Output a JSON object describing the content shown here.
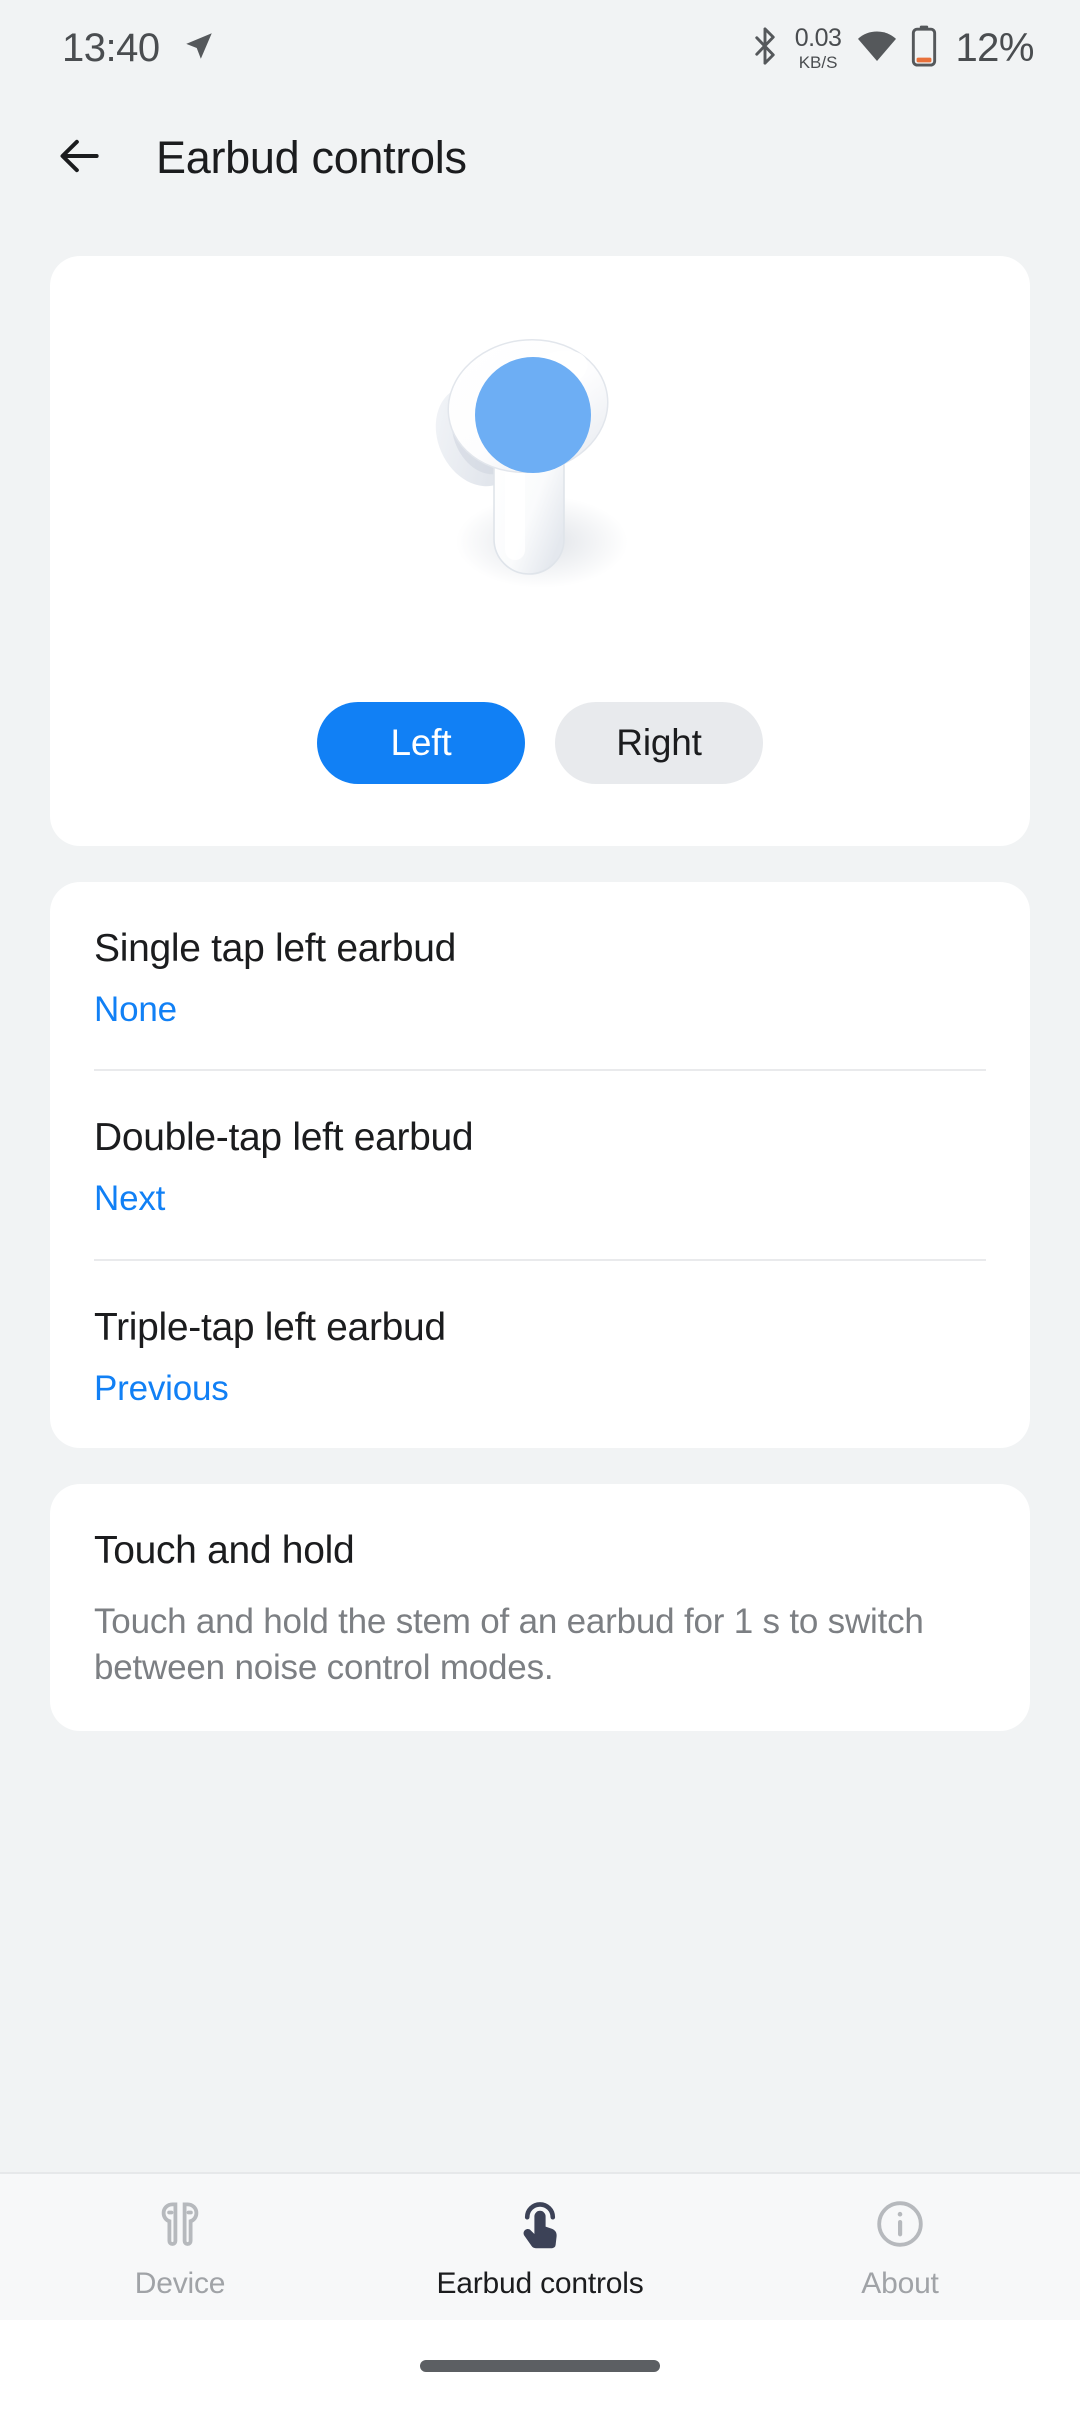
{
  "statusbar": {
    "time": "13:40",
    "location_icon": "navigation-arrow-icon",
    "bluetooth_icon": "bluetooth-icon",
    "net_speed_value": "0.03",
    "net_speed_unit": "KB/S",
    "wifi_icon": "wifi-icon",
    "battery_icon": "battery-low-icon",
    "battery_percent": "12%",
    "battery_color": "#e8703a",
    "text_color": "#4a4d50"
  },
  "appbar": {
    "back_icon": "back-arrow-icon",
    "title": "Earbud controls"
  },
  "hero": {
    "earbud_image_name": "left-earbud-illustration",
    "touch_area_color": "#6daef4",
    "segments": [
      {
        "label": "Left",
        "selected": true
      },
      {
        "label": "Right",
        "selected": false
      }
    ]
  },
  "settings": {
    "items": [
      {
        "title": "Single tap left earbud",
        "value": "None"
      },
      {
        "title": "Double-tap left earbud",
        "value": "Next"
      },
      {
        "title": "Triple-tap left earbud",
        "value": "Previous"
      }
    ]
  },
  "touch_and_hold": {
    "title": "Touch and hold",
    "description": "Touch and hold the stem of an earbud for 1 s to switch between noise control modes."
  },
  "bottom_nav": {
    "items": [
      {
        "label": "Device",
        "icon": "earbuds-icon",
        "active": false
      },
      {
        "label": "Earbud controls",
        "icon": "touch-gesture-icon",
        "active": true
      },
      {
        "label": "About",
        "icon": "info-circle-icon",
        "active": false
      }
    ]
  },
  "theme": {
    "accent": "#1180f5",
    "background": "#f1f3f4",
    "card": "#ffffff",
    "text_primary": "#1b1c1e",
    "text_secondary": "#7c7f83",
    "nav_active": "#3c4257",
    "nav_inactive": "#b6b9bd"
  }
}
